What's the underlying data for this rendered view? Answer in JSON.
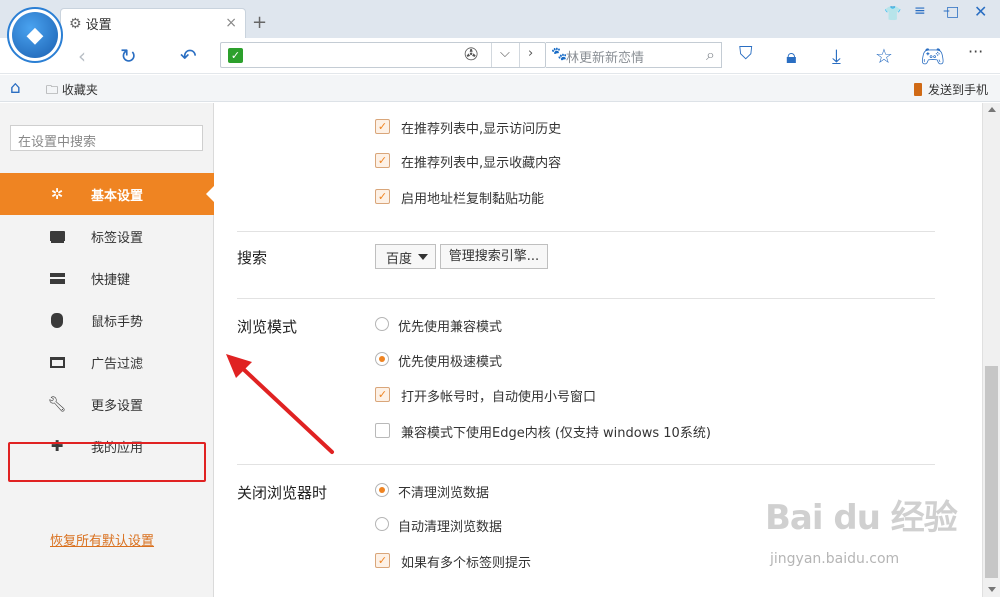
{
  "window": {
    "tab_title": "设置",
    "tab_icon": "gear-icon",
    "new_tab": "+",
    "close_tab": "×"
  },
  "toolbar": {
    "search_placeholder": "林更新新恋情",
    "address_value": ""
  },
  "bookmarks": {
    "favorites_label": "收藏夹",
    "send_to_phone": "发送到手机"
  },
  "sidebar": {
    "search_placeholder": "在设置中搜索",
    "items": [
      {
        "label": "基本设置",
        "icon": "gear-icon",
        "active": true
      },
      {
        "label": "标签设置",
        "icon": "laptop-icon"
      },
      {
        "label": "快捷键",
        "icon": "keyboard-icon"
      },
      {
        "label": "鼠标手势",
        "icon": "mouse-icon"
      },
      {
        "label": "广告过滤",
        "icon": "window-icon"
      },
      {
        "label": "更多设置",
        "icon": "wrench-icon"
      },
      {
        "label": "我的应用",
        "icon": "puzzle-icon"
      }
    ],
    "restore_link": "恢复所有默认设置"
  },
  "main": {
    "top_options": [
      {
        "label": "在推荐列表中,显示访问历史",
        "checked": true
      },
      {
        "label": "在推荐列表中,显示收藏内容",
        "checked": true
      },
      {
        "label": "启用地址栏复制黏贴功能",
        "checked": true
      }
    ],
    "search_section": {
      "title": "搜索",
      "engine": "百度",
      "manage_button": "管理搜索引擎..."
    },
    "browse_section": {
      "title": "浏览模式",
      "radio_compat": "优先使用兼容模式",
      "radio_fast": "优先使用极速模式",
      "multi_account": "打开多帐号时，自动使用小号窗口",
      "edge_kernel": "兼容模式下使用Edge内核 (仅支持 windows 10系统)"
    },
    "close_section": {
      "title": "关闭浏览器时",
      "radio_keep": "不清理浏览数据",
      "radio_auto": "自动清理浏览数据",
      "multi_tab_prompt": "如果有多个标签则提示"
    }
  },
  "watermark": {
    "brand": "Bai du 经验",
    "url": "jingyan.baidu.com"
  },
  "colors": {
    "accent": "#ef8422",
    "annotation": "#e02222",
    "blue": "#2a6ec2"
  }
}
